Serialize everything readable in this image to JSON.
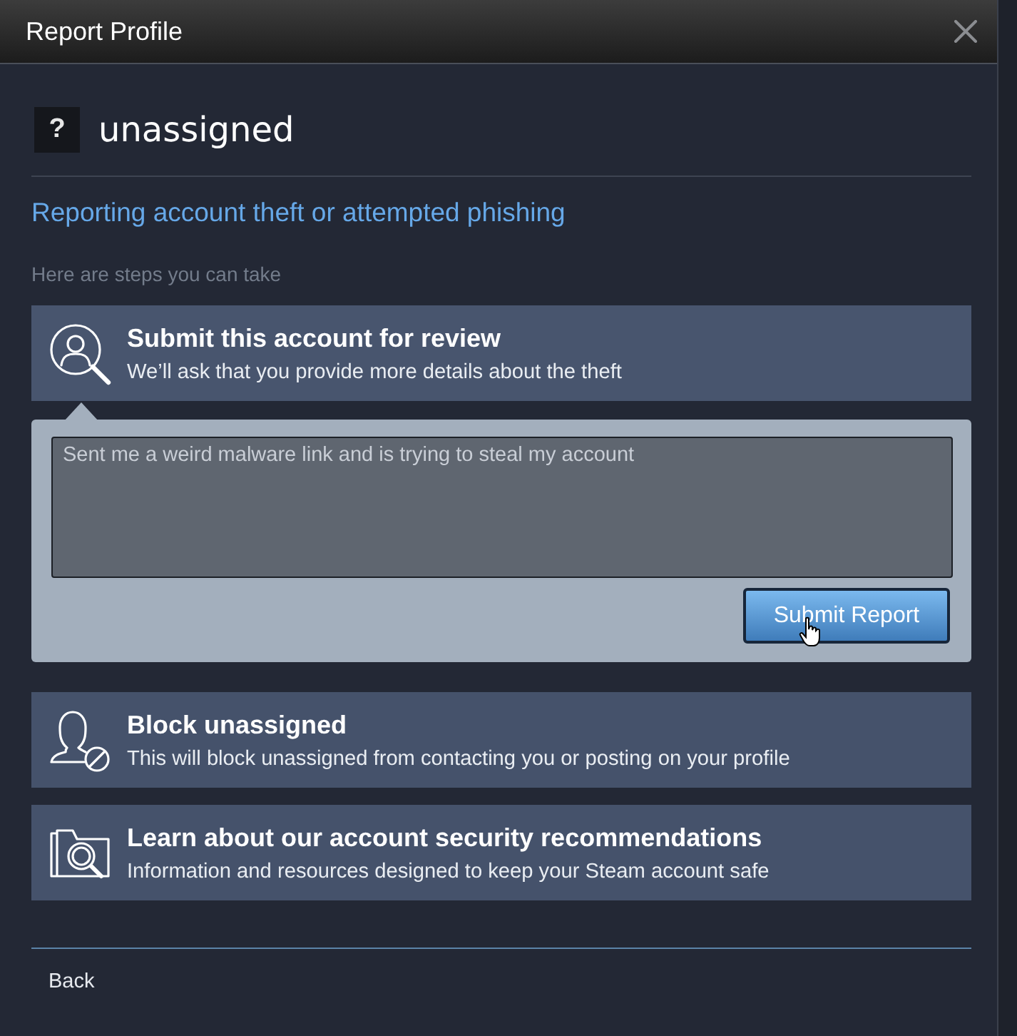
{
  "window": {
    "title": "Report Profile"
  },
  "profile": {
    "avatar": "?",
    "name": "unassigned"
  },
  "heading": "Reporting account theft or attempted phishing",
  "steps_label": "Here are steps you can take",
  "options": [
    {
      "kind": "review",
      "title": "Submit this account for review",
      "subtitle": "We’ll ask that you provide more details about the theft",
      "form": {
        "value": "Sent me a weird malware link and is trying to steal my account",
        "submit": "Submit Report"
      }
    },
    {
      "kind": "block",
      "title": "Block unassigned",
      "subtitle": "This will block unassigned from contacting you or posting on your profile"
    },
    {
      "kind": "learn",
      "title": "Learn about our account security recommendations",
      "subtitle": "Information and resources designed to keep your Steam account safe"
    }
  ],
  "footer": {
    "back": "Back"
  }
}
